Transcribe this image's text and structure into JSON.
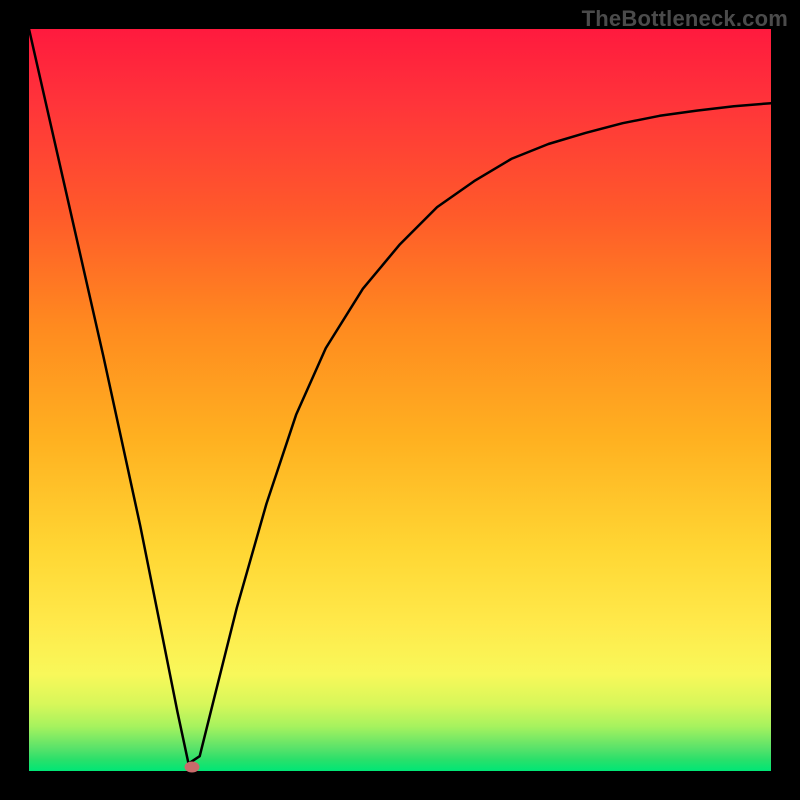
{
  "watermark": "TheBottleneck.com",
  "chart_data": {
    "type": "line",
    "title": "",
    "xlabel": "",
    "ylabel": "",
    "xlim": [
      0,
      100
    ],
    "ylim": [
      0,
      100
    ],
    "grid": false,
    "series": [
      {
        "name": "bottleneck-curve",
        "x": [
          0,
          5,
          10,
          15,
          18,
          20,
          21.5,
          23,
          25,
          28,
          32,
          36,
          40,
          45,
          50,
          55,
          60,
          65,
          70,
          75,
          80,
          85,
          90,
          95,
          100
        ],
        "values": [
          100,
          78,
          56,
          33,
          18,
          8,
          1,
          2,
          10,
          22,
          36,
          48,
          57,
          65,
          71,
          76,
          79.5,
          82.5,
          84.5,
          86,
          87.3,
          88.3,
          89,
          89.6,
          90
        ]
      }
    ],
    "marker": {
      "x": 22,
      "y": 0.5,
      "color": "#c96b6b"
    },
    "background_gradient": {
      "stops": [
        {
          "pos": 0,
          "color": "#ff1a3e"
        },
        {
          "pos": 0.25,
          "color": "#ff5a2a"
        },
        {
          "pos": 0.55,
          "color": "#ffb020"
        },
        {
          "pos": 0.8,
          "color": "#ffe94a"
        },
        {
          "pos": 0.94,
          "color": "#a6f25e"
        },
        {
          "pos": 1.0,
          "color": "#00e676"
        }
      ]
    }
  }
}
